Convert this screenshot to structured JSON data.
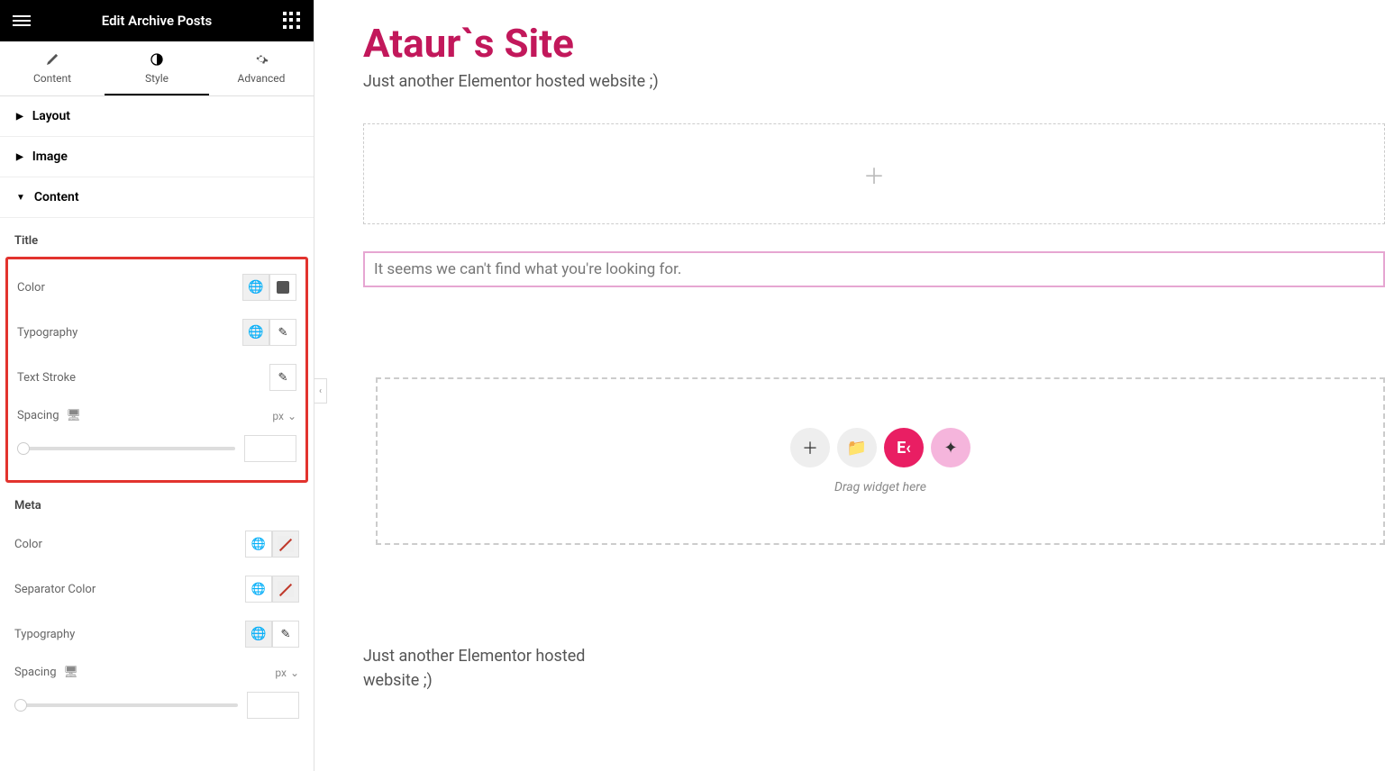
{
  "topbar": {
    "title": "Edit Archive Posts"
  },
  "tabs": {
    "content": "Content",
    "style": "Style",
    "advanced": "Advanced"
  },
  "sections": {
    "layout": "Layout",
    "image": "Image",
    "content": "Content"
  },
  "title_group": {
    "heading": "Title",
    "color": "Color",
    "typography": "Typography",
    "text_stroke": "Text Stroke",
    "spacing": "Spacing",
    "unit": "px"
  },
  "meta_group": {
    "heading": "Meta",
    "color": "Color",
    "separator_color": "Separator Color",
    "typography": "Typography",
    "spacing": "Spacing",
    "unit": "px"
  },
  "site": {
    "title": "Ataur`s Site",
    "tagline": "Just another Elementor hosted website ;)",
    "notfound": "It seems we can't find what you're looking for.",
    "drop_hint": "Drag widget here",
    "footer": "Just another Elementor hosted website ;)"
  }
}
